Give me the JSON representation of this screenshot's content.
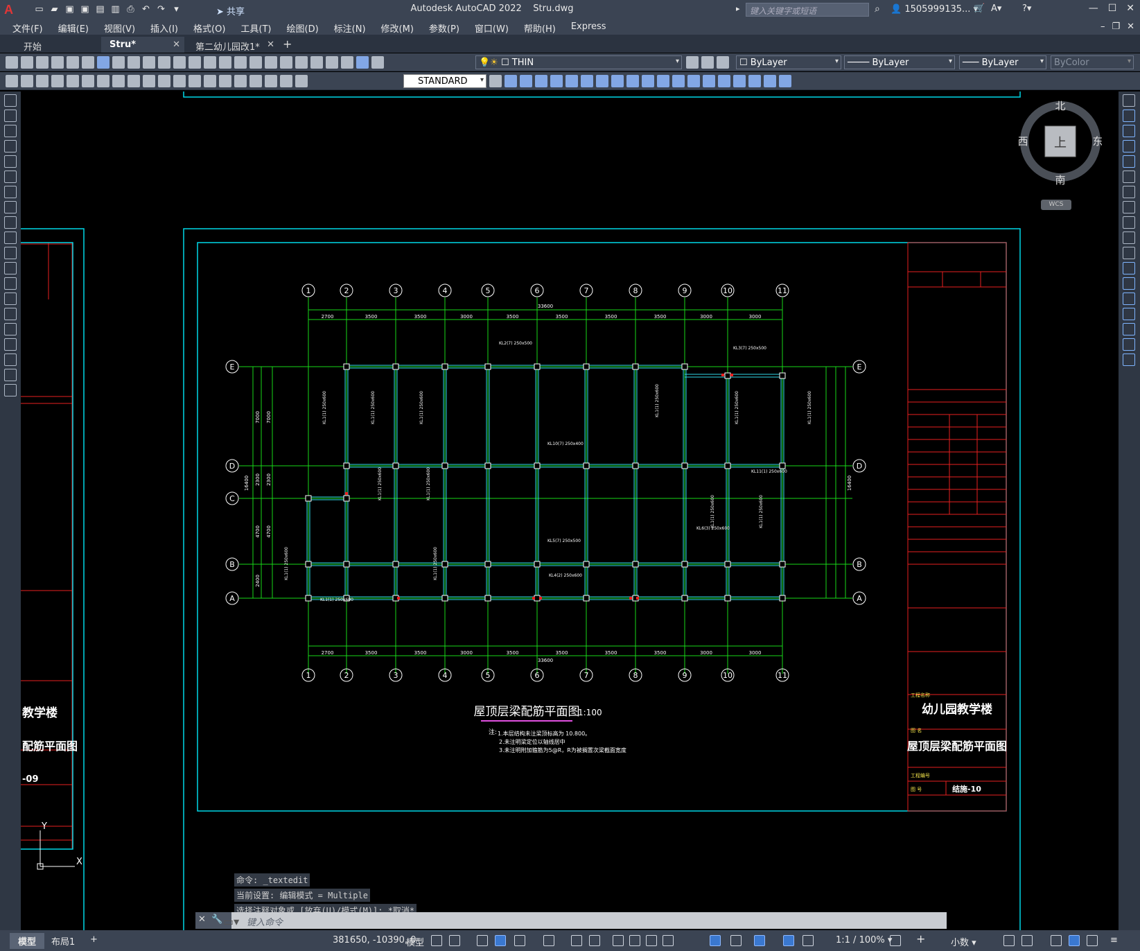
{
  "titlebar": {
    "logo": "A",
    "share_label": "共享",
    "app_title": "Autodesk AutoCAD 2022",
    "doc_title": "Stru.dwg",
    "search_placeholder": "键入关键字或短语",
    "user": "1505999135..."
  },
  "menu": [
    "文件(F)",
    "编辑(E)",
    "视图(V)",
    "插入(I)",
    "格式(O)",
    "工具(T)",
    "绘图(D)",
    "标注(N)",
    "修改(M)",
    "参数(P)",
    "窗口(W)",
    "帮助(H)",
    "Express"
  ],
  "tabs": [
    {
      "label": "开始"
    },
    {
      "label": "Stru*"
    },
    {
      "label": "第二幼儿园改1*"
    }
  ],
  "toolbar": {
    "layer": "THIN",
    "color": "ByLayer",
    "linetype": "ByLayer",
    "lineweight": "ByLayer",
    "plotstyle": "ByColor",
    "textstyle": "STANDARD"
  },
  "viewcube": {
    "north": "北",
    "south": "南",
    "east": "东",
    "west": "西",
    "top": "上",
    "wcs": "WCS"
  },
  "drawing": {
    "axes_top": [
      "1",
      "2",
      "3",
      "4",
      "5",
      "6",
      "7",
      "8",
      "9",
      "10",
      "11"
    ],
    "axes_rows": [
      "E",
      "D",
      "C",
      "B",
      "A"
    ],
    "spans": [
      "2700",
      "3500",
      "3500",
      "3000",
      "3500",
      "3500",
      "3500",
      "3500",
      "3000",
      "3000"
    ],
    "total_span": "33600",
    "title": "屋顶层梁配筋平面图",
    "scale": "1:100",
    "note_head": "注:",
    "notes": [
      "1.本层结构未注梁顶标高为 10.800。",
      "2.未注明梁定位以轴线居中",
      "3.未注明附加箍筋为5@R，R为被搁置次梁截面宽度"
    ],
    "left_dims": [
      "7000",
      "7000",
      "2300",
      "2300",
      "4700",
      "4700",
      "2400"
    ],
    "total_height": "16400",
    "beam_tags": [
      "KL1(1) 250x600",
      "KL2(7) 250x500",
      "KL3(7) 250x500",
      "KL10(7) 250x400",
      "KL5(7) 250x500",
      "KL4(2) 250x600",
      "KL6(3) 250x600",
      "KL11(1) 250x600"
    ]
  },
  "titleblock": {
    "project_label": "工程名称",
    "project": "幼儿园教学楼",
    "drawing_label": "图 名",
    "drawing_name": "屋顶层梁配筋平面图",
    "number_label": "工程编号",
    "no_label": "图 号",
    "number": "结施-10"
  },
  "leftsheet": {
    "project": "教学楼",
    "drawing_name": "配筋平面图",
    "number": "-09"
  },
  "ucs": {
    "x": "X",
    "y": "Y"
  },
  "command": {
    "history": [
      "命令: _textedit",
      "当前设置: 编辑模式 = Multiple",
      "选择注释对象或 [放弃(U)/模式(M)]: *取消*"
    ],
    "prompt": "键入命令"
  },
  "status": {
    "model_tab": "模型",
    "layout_tab": "布局1",
    "coords": "381650, -10390, 0",
    "model": "模型",
    "scale": "1:1 / 100%",
    "units": "小数"
  }
}
